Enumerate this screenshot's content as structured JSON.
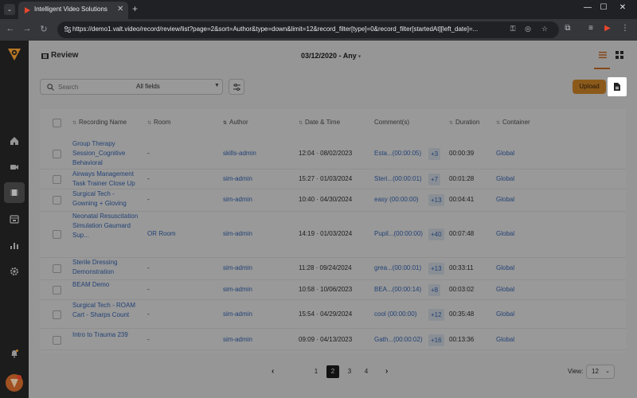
{
  "browser": {
    "tab_title": "Intelligent Video Solutions",
    "url": "https://demo1.valt.video/record/review/list?page=2&sort=Author&type=down&limit=12&record_filter[type]=0&record_filter[startedAt][left_date]=..."
  },
  "header": {
    "title": "Review",
    "date_filter": "03/12/2020 - Any"
  },
  "toolbar": {
    "search_placeholder": "Search",
    "field_filter": "All fields",
    "upload_label": "Upload"
  },
  "table": {
    "columns": [
      "Recording Name",
      "Room",
      "Author",
      "Date & Time",
      "Comment(s)",
      "Duration",
      "Container"
    ],
    "rows": [
      {
        "name": "Group Therapy Session_Cognitive Behavioral",
        "room": "-",
        "author": "skills-admin",
        "datetime": "12:04 · 08/02/2023",
        "comment": "Esta...(00:00:05)",
        "more": "+3",
        "duration": "00:00:39",
        "container": "Global"
      },
      {
        "name": "Airways Management Task Trainer Close Up",
        "room": "-",
        "author": "sim-admin",
        "datetime": "15:27 · 01/03/2024",
        "comment": "Steri...(00:00:01)",
        "more": "+7",
        "duration": "00:01:28",
        "container": "Global"
      },
      {
        "name": "Surgical Tech - Gowning + Gloving",
        "room": "-",
        "author": "sim-admin",
        "datetime": "10:40 · 04/30/2024",
        "comment": "easy (00:00:00)",
        "more": "+13",
        "duration": "00:04:41",
        "container": "Global"
      },
      {
        "name": "Neonatal Resuscitation Simulation Gaumard Sup...",
        "room": "OR Room",
        "author": "sim-admin",
        "datetime": "14:19 · 01/03/2024",
        "comment": "Pupil...(00:00:00)",
        "more": "+40",
        "duration": "00:07:48",
        "container": "Global"
      },
      {
        "name": "Sterile Dressing Demonstration",
        "room": "-",
        "author": "sim-admin",
        "datetime": "11:28 · 09/24/2024",
        "comment": "grea...(00:00:01)",
        "more": "+13",
        "duration": "00:33:11",
        "container": "Global"
      },
      {
        "name": "BEAM Demo",
        "room": "-",
        "author": "sim-admin",
        "datetime": "10:58 · 10/06/2023",
        "comment": "BEA...(00:00:14)",
        "more": "+8",
        "duration": "00:03:02",
        "container": "Global"
      },
      {
        "name": "Surgical Tech - ROAM Cart - Sharps Count",
        "room": "-",
        "author": "sim-admin",
        "datetime": "15:54 · 04/29/2024",
        "comment": "cool (00:00:00)",
        "more": "+12",
        "duration": "00:35:48",
        "container": "Global"
      },
      {
        "name": "Intro to Trauma 239",
        "room": "-",
        "author": "sim-admin",
        "datetime": "09:09 · 04/13/2023",
        "comment": "Gath...(00:00:02)",
        "more": "+16",
        "duration": "00:13:36",
        "container": "Global"
      }
    ]
  },
  "pagination": {
    "pages": [
      "1",
      "2",
      "3",
      "4"
    ],
    "current": "2",
    "view_label": "View:",
    "view_value": "12"
  },
  "colors": {
    "accent": "#e8962e",
    "link": "#3b6fc4",
    "sidebar": "#242424"
  }
}
